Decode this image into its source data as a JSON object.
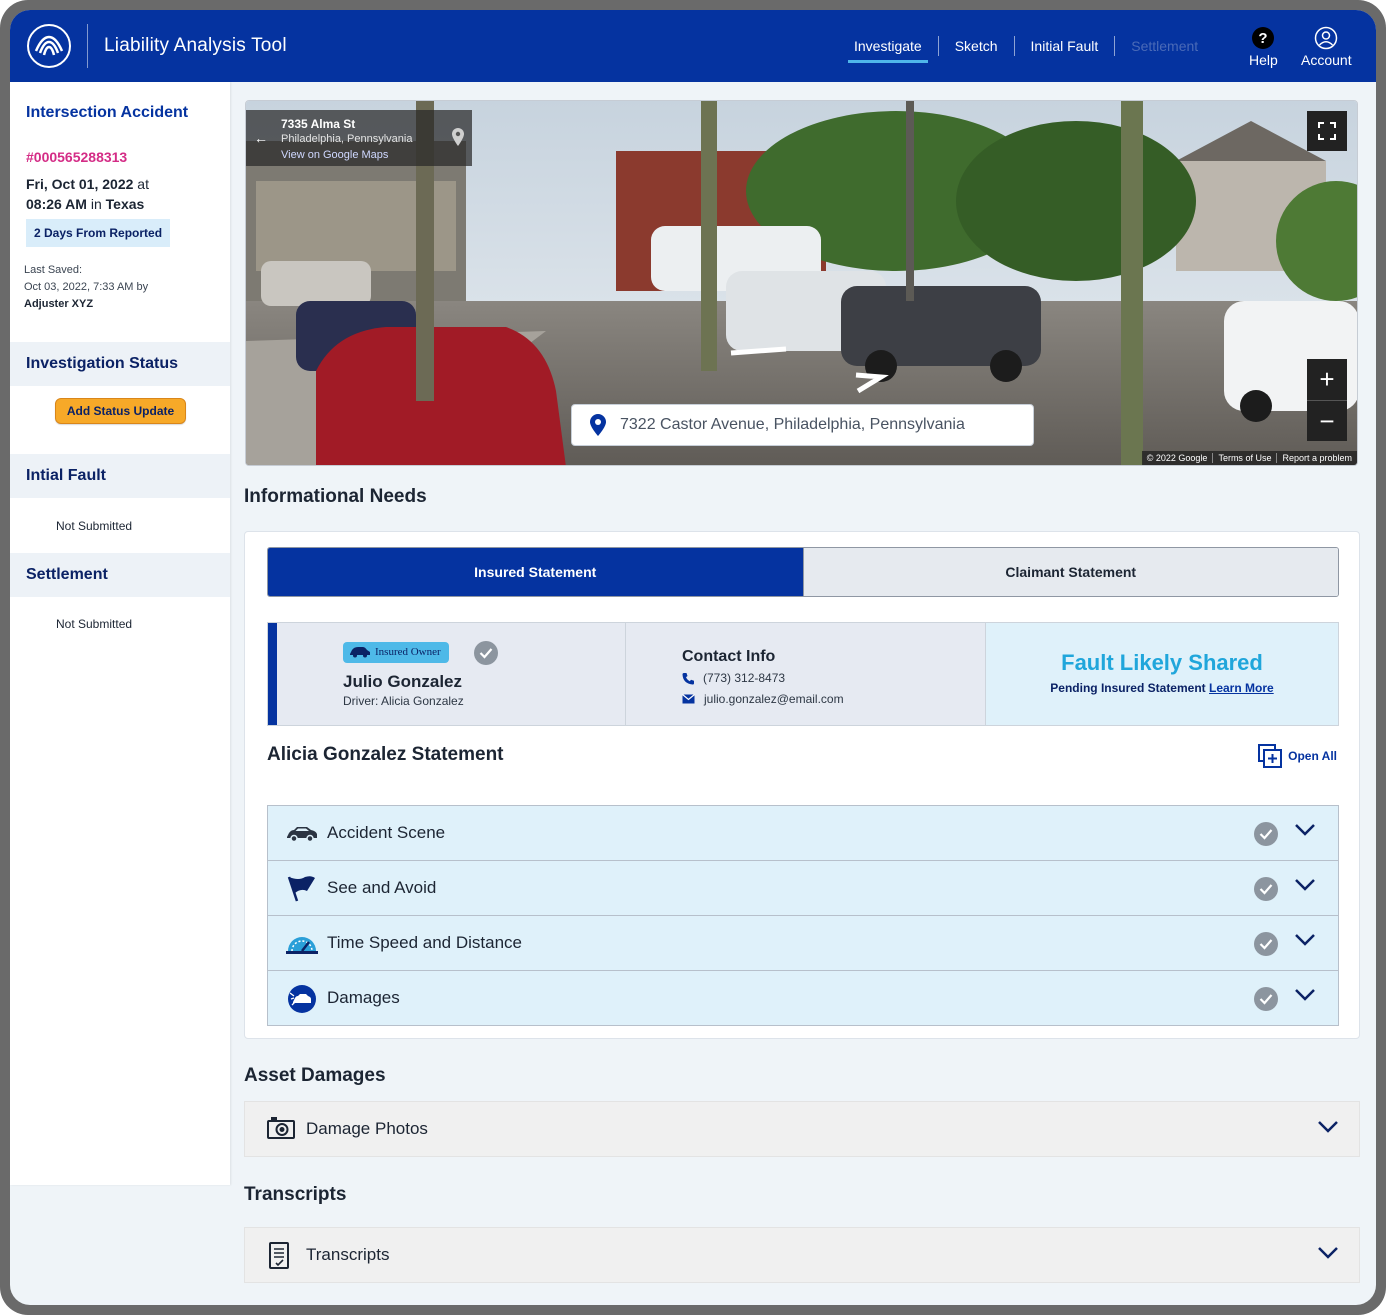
{
  "header": {
    "app_title": "Liability Analysis Tool",
    "nav": [
      "Investigate",
      "Sketch",
      "Initial Fault",
      "Settlement"
    ],
    "help_label": "Help",
    "account_label": "Account",
    "colors": {
      "brand": "#0533a0",
      "active_underline": "#4fb6ea"
    }
  },
  "sidebar": {
    "title": "Intersection Accident",
    "claim_number": "#000565288313",
    "date_line1_bold": "Fri, Oct 01, 2022",
    "date_line1_rest": " at",
    "date_line2_time": "08:26 AM",
    "date_line2_mid": " in ",
    "date_line2_state": "Texas",
    "badge": "2 Days From Reported",
    "last_saved_label": "Last Saved:",
    "last_saved_value": "Oct 03, 2022, 7:33 AM by",
    "last_saved_by": "Adjuster XYZ",
    "investigation_status": "Investigation Status",
    "add_status_button": "Add Status Update",
    "initial_fault": "Intial Fault",
    "initial_fault_status": "Not Submitted",
    "settlement": "Settlement",
    "settlement_status": "Not Submitted"
  },
  "street_view": {
    "street": "7335 Alma St",
    "city": "Philadelphia, Pennsylvania",
    "maps_link": "View on Google Maps",
    "search_value": "7322 Castor Avenue, Philadelphia, Pennsylvania",
    "copyright": "© 2022 Google",
    "terms": "Terms of Use",
    "report": "Report a problem",
    "zoom_in": "+",
    "zoom_out": "−"
  },
  "informational_needs": {
    "heading": "Informational Needs",
    "tabs": [
      "Insured Statement",
      "Claimant Statement"
    ],
    "active_tab": "Insured Statement",
    "party": {
      "tag": "Insured Owner",
      "name": "Julio Gonzalez",
      "driver": "Driver: Alicia Gonzalez",
      "contact_title": "Contact Info",
      "phone": "(773) 312-8473",
      "email": "julio.gonzalez@email.com",
      "fault_title": "Fault Likely Shared",
      "fault_sub": "Pending Insured Statement",
      "learn_more": "Learn More"
    },
    "statement_title": "Alicia Gonzalez Statement",
    "open_all": "Open All",
    "sections": [
      {
        "label": "Accident Scene",
        "icon": "car-icon"
      },
      {
        "label": "See and Avoid",
        "icon": "flag-icon"
      },
      {
        "label": "Time Speed and Distance",
        "icon": "speedometer-icon"
      },
      {
        "label": "Damages",
        "icon": "car-damage-icon"
      }
    ]
  },
  "asset_damages": {
    "heading": "Asset Damages",
    "item": "Damage Photos"
  },
  "transcripts": {
    "heading": "Transcripts",
    "item": "Transcripts"
  }
}
